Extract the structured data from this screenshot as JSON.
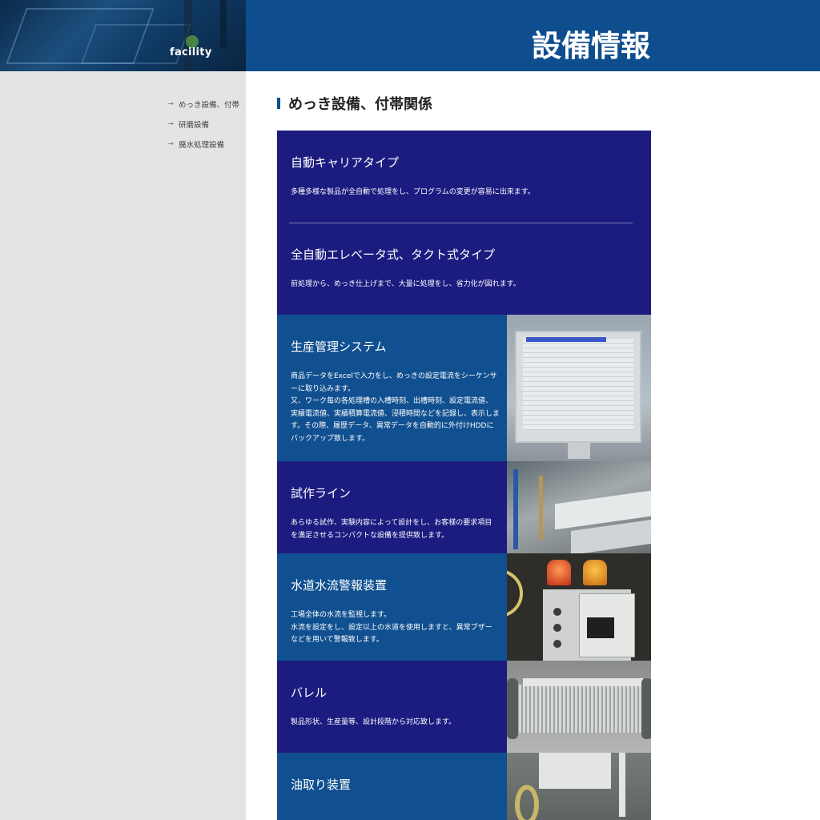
{
  "header": {
    "facility_label": "facility",
    "page_title": "設備情報"
  },
  "sidebar": {
    "items": [
      {
        "label": "めっき設備、付帯"
      },
      {
        "label": "研磨設備"
      },
      {
        "label": "廃水処理設備"
      }
    ]
  },
  "main": {
    "section_title": "めっき設備、付帯関係",
    "cards": [
      {
        "title": "自動キャリアタイプ",
        "lines": [
          "多種多様な製品が全自動で処理をし、プログラムの変更が容易に出来ます。"
        ]
      },
      {
        "title": "全自動エレベータ式、タクト式タイプ",
        "lines": [
          "前処理から、めっき仕上げまで、大量に処理をし、省力化が図れます。"
        ]
      },
      {
        "title": "生産管理システム",
        "lines": [
          "商品データをExcelで入力をし、めっきの設定電流をシーケンサ",
          "ーに取り込みます。",
          "又、ワーク毎の各処理槽の入槽時刻、出槽時刻、設定電流値、",
          "実績電流値、実績積算電流値、浸積時間などを記録し、表示しま",
          "す。その際、履歴データ、異常データを自動的に外付けHDDに",
          "バックアップ致します。"
        ]
      },
      {
        "title": "試作ライン",
        "lines": [
          "あらゆる試作、実験内容によって設計をし、お客様の要求項目",
          "を満足させるコンパクトな設備を提供致します。"
        ]
      },
      {
        "title": "水道水流警報装置",
        "lines": [
          "工場全体の水流を監視します。",
          "水流を設定をし、設定以上の水道を使用しますと、異常ブザー",
          "などを用いて警報致します。"
        ]
      },
      {
        "title": "バレル",
        "lines": [
          "製品形状、生産量等、設計段階から対応致します。"
        ]
      },
      {
        "title": "油取り装置",
        "lines": []
      }
    ]
  },
  "colors": {
    "header_bg": "#0e4e8e",
    "sidebar_bg": "#e4e4e4",
    "card_navy": "#1c1b80",
    "card_teal": "#115090"
  }
}
